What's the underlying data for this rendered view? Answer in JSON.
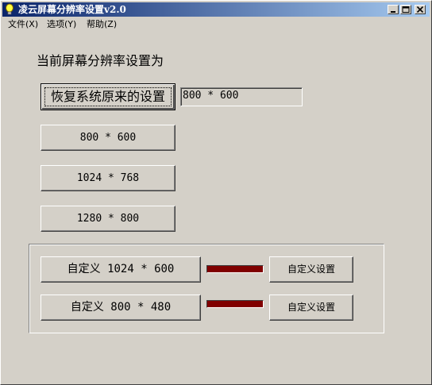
{
  "window": {
    "title": "凌云屏幕分辨率设置v2.0"
  },
  "menu": [
    {
      "label": "文件(X)"
    },
    {
      "label": "选项(Y)"
    },
    {
      "label": "帮助(Z)"
    }
  ],
  "heading": "当前屏幕分辨率设置为",
  "restore_button": "恢复系统原来的设置",
  "current_resolution": "800 * 600",
  "presets": [
    {
      "label": "800 * 600"
    },
    {
      "label": "1024 * 768"
    },
    {
      "label": "1280 * 800"
    }
  ],
  "custom": [
    {
      "label": "自定义 1024 * 600",
      "settings_label": "自定义设置",
      "color": "#800000"
    },
    {
      "label": "自定义 800 * 480",
      "settings_label": "自定义设置",
      "color": "#800000"
    }
  ],
  "colors": {
    "titlebar_start": "#0a246a",
    "titlebar_end": "#a6caf0",
    "face": "#d4d0c8"
  }
}
